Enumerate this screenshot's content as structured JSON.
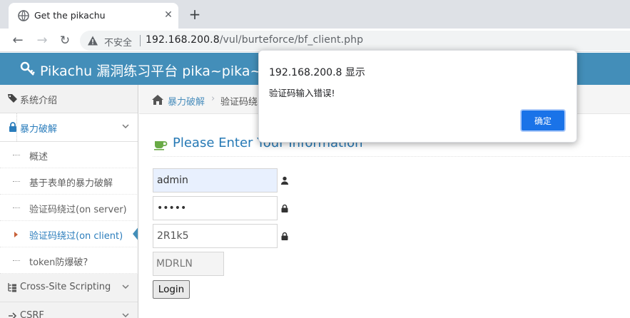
{
  "browser": {
    "tab_title": "Get the pikachu",
    "new_tab_symbol": "+",
    "security_label": "不安全",
    "url_host": "192.168.200.8",
    "url_path": "/vul/burteforce/bf_client.php"
  },
  "site": {
    "brand": "Pikachu 漏洞练习平台 pika~pika~",
    "header_color": "#438eb9"
  },
  "sidebar": {
    "intro": "系统介绍",
    "brute": "暴力破解",
    "sub_items": [
      "概述",
      "基于表单的暴力破解",
      "验证码绕过(on server)",
      "验证码绕过(on client)",
      "token防爆破?"
    ],
    "xss": "Cross-Site Scripting",
    "csrf": "CSRF"
  },
  "breadcrumb": {
    "link": "暴力破解",
    "separator": "›",
    "current": "验证码绕"
  },
  "form": {
    "title": "Please Enter Your Information",
    "username": "admin",
    "password": "•••••",
    "captcha_input": "2R1k5",
    "captcha_image_text": "MDRLN",
    "login_label": "Login"
  },
  "dialog": {
    "title": "192.168.200.8 显示",
    "message": "验证码输入错误!",
    "ok_label": "确定"
  },
  "colors": {
    "accent": "#438eb9",
    "link": "#2b7dbc",
    "dialog_button": "#1a73e8"
  }
}
